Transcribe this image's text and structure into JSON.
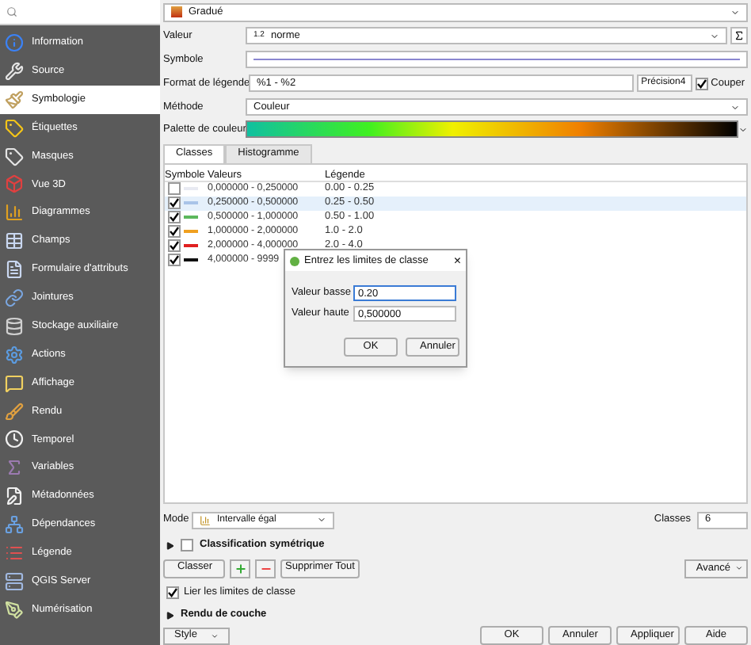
{
  "sidebar": {
    "items": [
      {
        "label": "Information",
        "selected": false
      },
      {
        "label": "Source",
        "selected": false
      },
      {
        "label": "Symbologie",
        "selected": true
      },
      {
        "label": "Étiquettes",
        "selected": false
      },
      {
        "label": "Masques",
        "selected": false
      },
      {
        "label": "Vue 3D",
        "selected": false
      },
      {
        "label": "Diagrammes",
        "selected": false
      },
      {
        "label": "Champs",
        "selected": false
      },
      {
        "label": "Formulaire d'attributs",
        "selected": false
      },
      {
        "label": "Jointures",
        "selected": false
      },
      {
        "label": "Stockage auxiliaire",
        "selected": false
      },
      {
        "label": "Actions",
        "selected": false
      },
      {
        "label": "Affichage",
        "selected": false
      },
      {
        "label": "Rendu",
        "selected": false
      },
      {
        "label": "Temporel",
        "selected": false
      },
      {
        "label": "Variables",
        "selected": false
      },
      {
        "label": "Métadonnées",
        "selected": false
      },
      {
        "label": "Dépendances",
        "selected": false
      },
      {
        "label": "Légende",
        "selected": false
      },
      {
        "label": "QGIS Server",
        "selected": false
      },
      {
        "label": "Numérisation",
        "selected": false
      }
    ]
  },
  "renderer": "Gradué",
  "fields": {
    "value_label": "Valeur",
    "value_badge": "1.2",
    "value": "norme",
    "symbol_label": "Symbole",
    "format_label": "Format de légende",
    "format": "%1 - %2",
    "precision": "Précision4",
    "clip_label": "Couper",
    "clip_checked": true,
    "method_label": "Méthode",
    "method": "Couleur",
    "palette_label": "Palette de couleur"
  },
  "tabs": [
    {
      "label": "Classes",
      "selected": true
    },
    {
      "label": "Histogramme",
      "selected": false
    }
  ],
  "table": {
    "columns": [
      "Symbole",
      "Valeurs",
      "Légende"
    ],
    "rows": [
      {
        "checked": false,
        "selected": false,
        "color": "#e8eaf2",
        "values": "0,000000 - 0,250000",
        "legend": "0.00 - 0.25"
      },
      {
        "checked": true,
        "selected": true,
        "color": "#a9c4e8",
        "values": "0,250000 - 0,500000",
        "legend": "0.25 - 0.50"
      },
      {
        "checked": true,
        "selected": false,
        "color": "#5cb85c",
        "values": "0,500000 - 1,000000",
        "legend": "0.50 - 1.00"
      },
      {
        "checked": true,
        "selected": false,
        "color": "#f0a020",
        "values": "1,000000 - 2,000000",
        "legend": "1.0 - 2.0"
      },
      {
        "checked": true,
        "selected": false,
        "color": "#e02020",
        "values": "2,000000 - 4,000000",
        "legend": "2.0 - 4.0"
      },
      {
        "checked": true,
        "selected": false,
        "color": "#101010",
        "values": "4,000000 - 9999",
        "legend": ""
      }
    ]
  },
  "dialog": {
    "title": "Entrez les limites de classe",
    "close": "×",
    "low_label": "Valeur basse",
    "low": "0.20",
    "high_label": "Valeur haute",
    "high": "0,500000",
    "ok": "OK",
    "cancel": "Annuler"
  },
  "mode": {
    "label": "Mode",
    "value": "Intervalle égal",
    "classes_label": "Classes",
    "classes": "6"
  },
  "symmetric": {
    "label": "Classification symétrique",
    "checked": false
  },
  "buttons": {
    "classify": "Classer",
    "delete_all": "Supprimer Tout",
    "advanced": "Avancé"
  },
  "link": {
    "label": "Lier les limites de classe",
    "checked": true
  },
  "layer_rendering": "Rendu de couche",
  "footer": {
    "style": "Style",
    "ok": "OK",
    "cancel": "Annuler",
    "apply": "Appliquer",
    "help": "Aide"
  }
}
